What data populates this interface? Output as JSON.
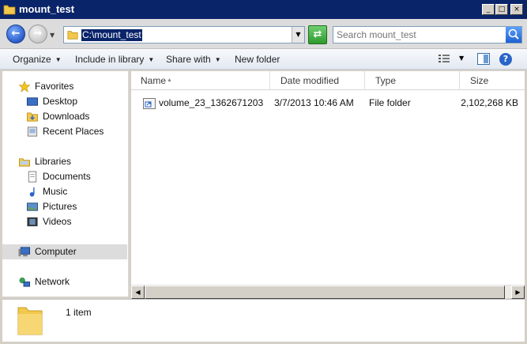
{
  "window": {
    "title": "mount_test"
  },
  "caption_buttons": {
    "minimize": "_",
    "maximize": "□",
    "close": "×"
  },
  "address": {
    "path": "C:\\mount_test"
  },
  "search": {
    "placeholder": "Search mount_test"
  },
  "toolbar": {
    "organize": "Organize",
    "include_in_library": "Include in library",
    "share_with": "Share with",
    "new_folder": "New folder",
    "help": "?"
  },
  "nav": {
    "favorites": "Favorites",
    "desktop": "Desktop",
    "downloads": "Downloads",
    "recent_places": "Recent Places",
    "libraries": "Libraries",
    "documents": "Documents",
    "music": "Music",
    "pictures": "Pictures",
    "videos": "Videos",
    "computer": "Computer",
    "network": "Network"
  },
  "columns": {
    "name": "Name",
    "date_modified": "Date modified",
    "type": "Type",
    "size": "Size"
  },
  "files": [
    {
      "name": "volume_23_1362671203",
      "date": "3/7/2013 10:46 AM",
      "type": "File folder",
      "size": "2,102,268 KB"
    }
  ],
  "details": {
    "count": "1 item"
  },
  "colors": {
    "title_bar": "#0a246a",
    "selection": "#0a246a",
    "nav_selected": "#dcdcdc"
  },
  "icons": {
    "title": "folder-icon",
    "back": "back-arrow-icon",
    "forward": "forward-arrow-icon",
    "refresh": "refresh-icon",
    "search": "search-icon",
    "views": "view-options-icon",
    "preview_pane": "preview-pane-icon",
    "help": "help-icon"
  }
}
